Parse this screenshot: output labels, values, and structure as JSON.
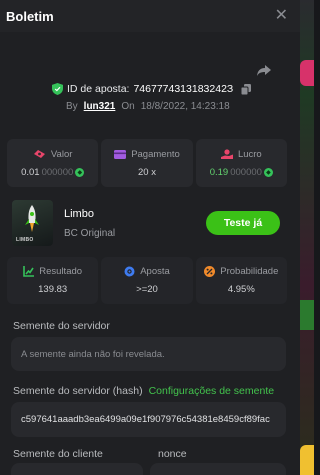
{
  "header": {
    "title": "Boletim"
  },
  "bet": {
    "id_label": "ID de aposta:",
    "id_value": "7467774313183242З",
    "by_label": "By",
    "username": "lun321",
    "on_label": "On",
    "datetime": "18/8/2022, 14:23:18"
  },
  "stats": [
    {
      "label": "Valor",
      "value_main": "0.01",
      "value_dim": "000000",
      "value_color": "default",
      "icon": "money-icon"
    },
    {
      "label": "Pagamento",
      "value_main": "20 x",
      "value_dim": "",
      "value_color": "default",
      "icon": "card-icon"
    },
    {
      "label": "Lucro",
      "value_main": "0.19",
      "value_dim": "000000",
      "value_color": "green",
      "icon": "hand-coin-icon"
    }
  ],
  "game": {
    "name": "Limbo",
    "provider": "BC Original",
    "thumb_label": "LIMBO",
    "try_label": "Teste já"
  },
  "results": [
    {
      "label": "Resultado",
      "value": "139.83",
      "icon": "chart-icon"
    },
    {
      "label": "Aposta",
      "value": ">=20",
      "icon": "target-icon"
    },
    {
      "label": "Probabilidade",
      "value": "4.95%",
      "icon": "percent-icon"
    }
  ],
  "seeds": {
    "server_label": "Semente do servidor",
    "server_value": "A semente ainda não foi revelada.",
    "server_hash_label": "Semente do servidor (hash)",
    "settings_link": "Configurações de semente",
    "server_hash_value": "c597641aaadb3ea6499a09e1f907976c54381e8459cf89fac",
    "client_label": "Semente do cliente",
    "nonce_label": "nonce"
  },
  "colors": {
    "accent_green": "#3bc117",
    "panel": "#1f2023",
    "card": "#28292d"
  }
}
